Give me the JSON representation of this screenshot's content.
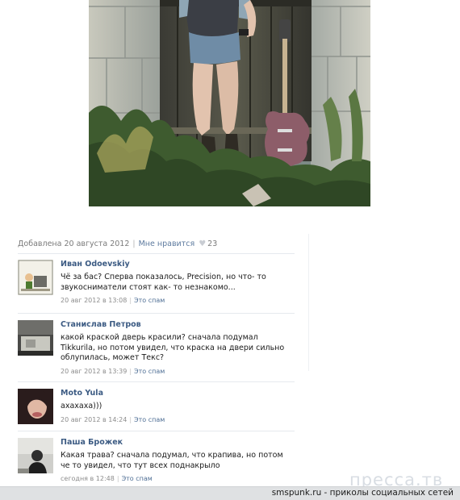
{
  "post": {
    "added_date": "Добавлена 20 августа 2012",
    "separator": "|",
    "like_label": "Мне нравится",
    "like_count": "23"
  },
  "comments": [
    {
      "author": "Иван Odoevskiy",
      "text": "Чё за бас? Сперва показалось, Precision, но что- то звукосниматели стоят как- то незнакомо...",
      "date": "20 авг 2012 в 13:08",
      "spam_label": "Это спам"
    },
    {
      "author": "Станислав Петров",
      "text": "какой краской дверь красили? сначала подумал Tikkurila, но потом увидел, что краска на двери сильно облупилась, может Текс?",
      "date": "20 авг 2012 в 13:39",
      "spam_label": "Это спам"
    },
    {
      "author": "Moto Yula",
      "text": "ахахаха)))",
      "date": "20 авг 2012 в 14:24",
      "spam_label": "Это спам"
    },
    {
      "author": "Паша Брожек",
      "text": "Какая трава? сначала подумал, что крапива, но потом че то увидел, что тут всех поднакрыло",
      "date": "сегодня в 12:48",
      "spam_label": "Это спам"
    }
  ],
  "watermark": "пресса.тв",
  "footer": "smspunk.ru - приколы социальных сетей"
}
